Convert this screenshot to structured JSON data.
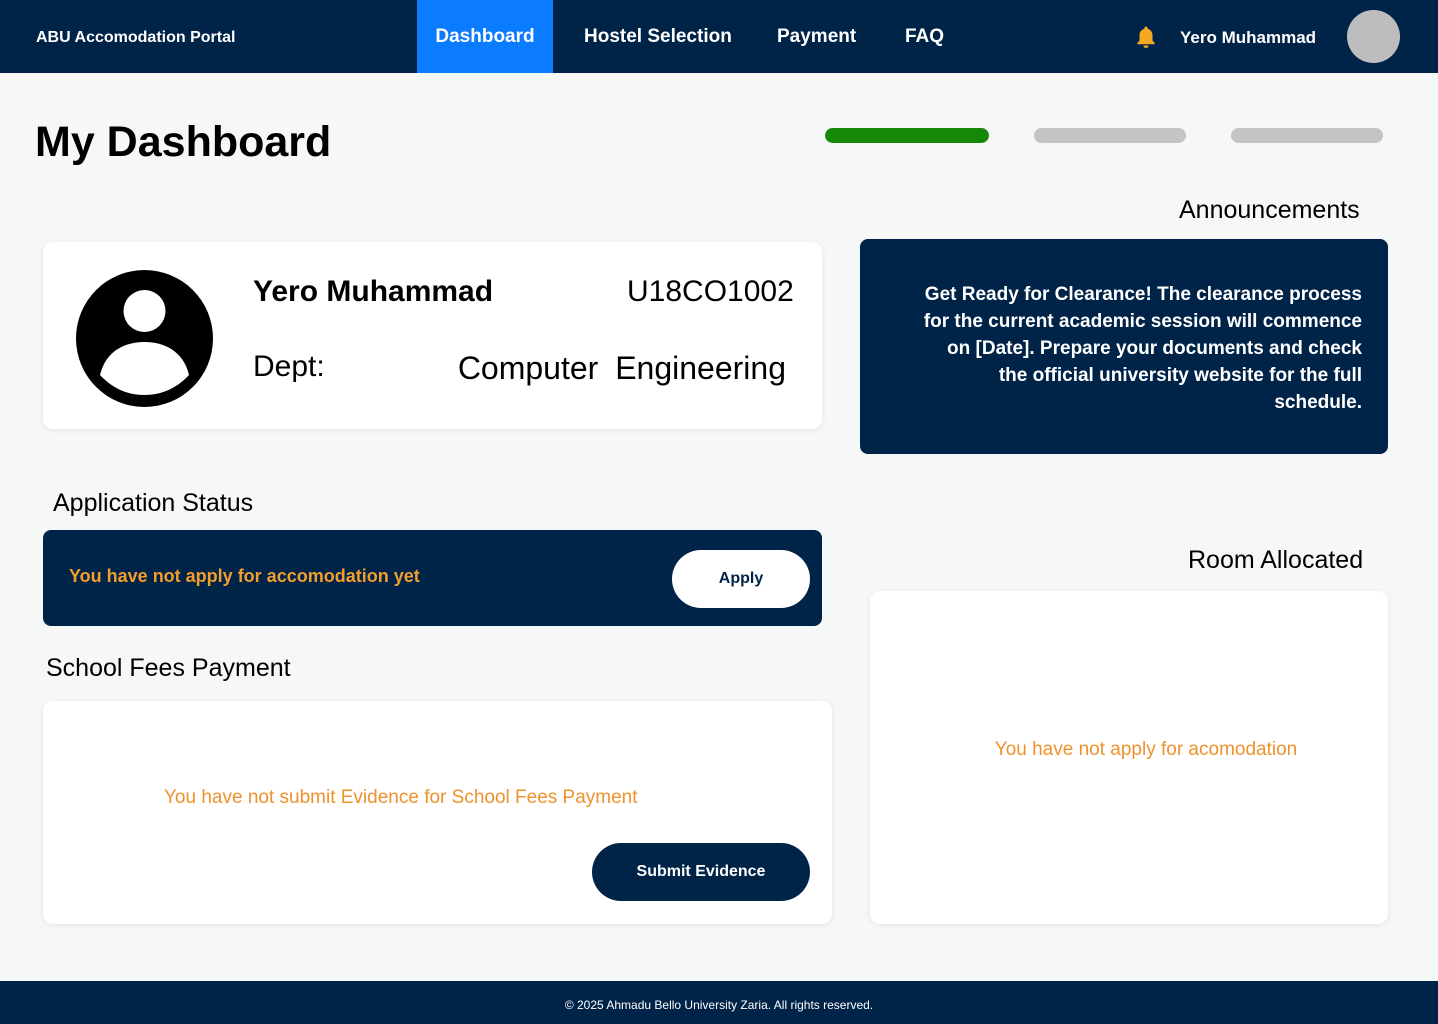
{
  "navbar": {
    "brand": "ABU Accomodation Portal",
    "items": [
      {
        "label": "Dashboard",
        "active": true
      },
      {
        "label": "Hostel Selection",
        "active": false
      },
      {
        "label": "Payment",
        "active": false
      },
      {
        "label": "FAQ",
        "active": false
      }
    ],
    "notification_icon": "bell-icon",
    "user_name": "Yero Muhammad",
    "bell_color": "#f5a623",
    "background_color": "#002348",
    "active_color": "#0b7bff"
  },
  "page": {
    "title": "My Dashboard"
  },
  "progress_steps": [
    {
      "complete": 1.0,
      "color": "#168808"
    },
    {
      "complete": 0.0,
      "color": "#c4c4c4"
    },
    {
      "complete": 0.0,
      "color": "#c4c4c4"
    }
  ],
  "profile": {
    "name": "Yero Muhammad",
    "id": "U18CO1002",
    "dept_label": "Dept:",
    "dept": "Computer  Engineering",
    "avatar_icon": "user-circle-icon"
  },
  "announcements": {
    "title": "Announcements",
    "text": "Get Ready for Clearance! The clearance process for the current academic session will commence on [Date]. Prepare your documents and check the official university website for the full schedule."
  },
  "application_status": {
    "title": "Application Status",
    "message": "You have not apply for accomodation yet",
    "apply_label": "Apply"
  },
  "school_fees": {
    "title": "School Fees Payment",
    "message": "You have not submit Evidence for School Fees Payment",
    "submit_label": "Submit Evidence"
  },
  "room": {
    "title": "Room Allocated",
    "message": "You have not apply for acomodation"
  },
  "footer": {
    "text": "© 2025 Ahmadu Bello University Zaria. All rights reserved."
  }
}
